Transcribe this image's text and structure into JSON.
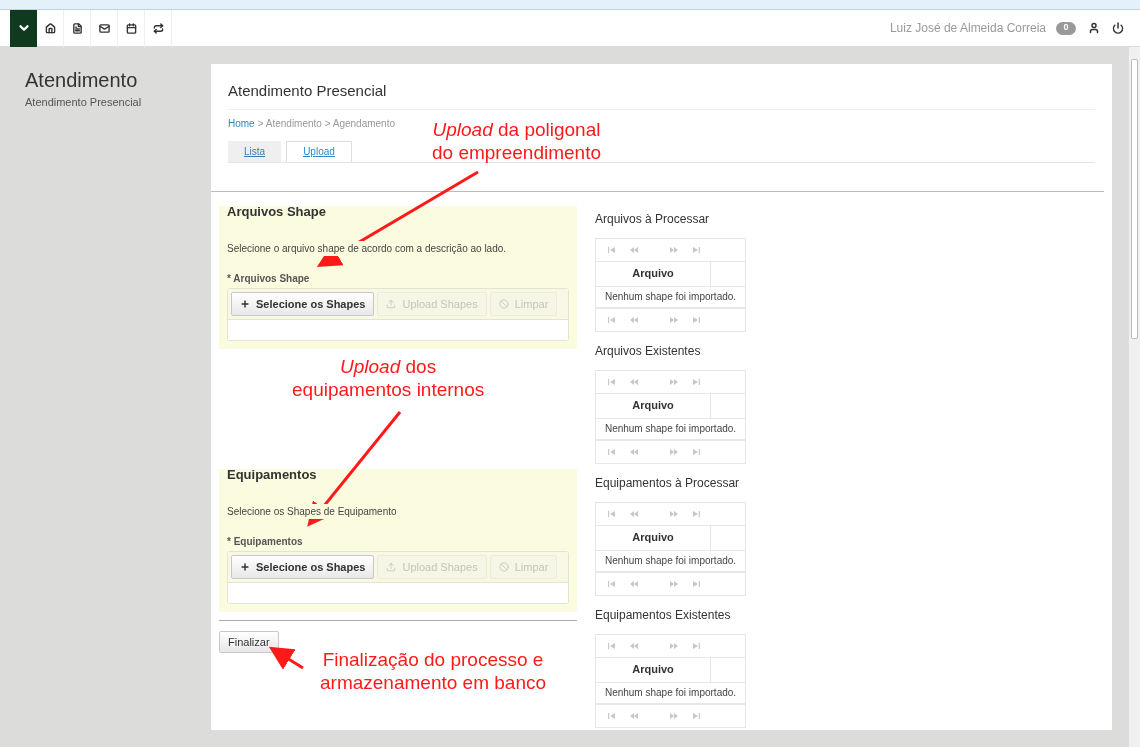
{
  "topbar": {
    "user_name": "Luiz José de Almeida Correia",
    "notification_count": "0"
  },
  "sidebar": {
    "title": "Atendimento",
    "subtitle": "Atendimento Presencial"
  },
  "panel": {
    "title": "Atendimento Presencial",
    "breadcrumb": [
      {
        "label": "Home",
        "link": true
      },
      {
        "label": "> Atendimento > Agendamento",
        "link": false
      }
    ],
    "tabs": [
      {
        "label": "Lista",
        "selected": false
      },
      {
        "label": "Upload",
        "selected": true
      }
    ],
    "upload_sections": [
      {
        "heading": "Arquivos Shape",
        "description": "Selecione o arquivo shape de acordo com a descrição ao lado.",
        "field_label": "* Arquivos Shape",
        "buttons": [
          {
            "kind": "add",
            "label": "Selecione os Shapes",
            "disabled": false
          },
          {
            "kind": "upload",
            "label": "Upload Shapes",
            "disabled": true
          },
          {
            "kind": "clear",
            "label": "Limpar",
            "disabled": true
          }
        ]
      },
      {
        "heading": "Equipamentos",
        "description": "Selecione os Shapes de Equipamento",
        "field_label": "* Equipamentos",
        "buttons": [
          {
            "kind": "add",
            "label": "Selecione os Shapes",
            "disabled": false
          },
          {
            "kind": "upload",
            "label": "Upload Shapes",
            "disabled": true
          },
          {
            "kind": "clear",
            "label": "Limpar",
            "disabled": true
          }
        ]
      }
    ],
    "finish_button": "Finalizar",
    "file_tables": [
      {
        "title": "Arquivos à Processar",
        "column": "Arquivo",
        "empty_message": "Nenhum shape foi importado."
      },
      {
        "title": "Arquivos Existentes",
        "column": "Arquivo",
        "empty_message": "Nenhum shape foi importado."
      },
      {
        "title": "Equipamentos à Processar",
        "column": "Arquivo",
        "empty_message": "Nenhum shape foi importado."
      },
      {
        "title": "Equipamentos Existentes",
        "column": "Arquivo",
        "empty_message": "Nenhum shape foi importado."
      }
    ]
  },
  "annotations": [
    {
      "lines": [
        "*Upload* da poligonal",
        "do empreendimento"
      ]
    },
    {
      "lines": [
        "*Upload* dos",
        "equipamentos internos"
      ]
    },
    {
      "lines": [
        "Finalização do processo e",
        "armazenamento em banco"
      ]
    }
  ]
}
